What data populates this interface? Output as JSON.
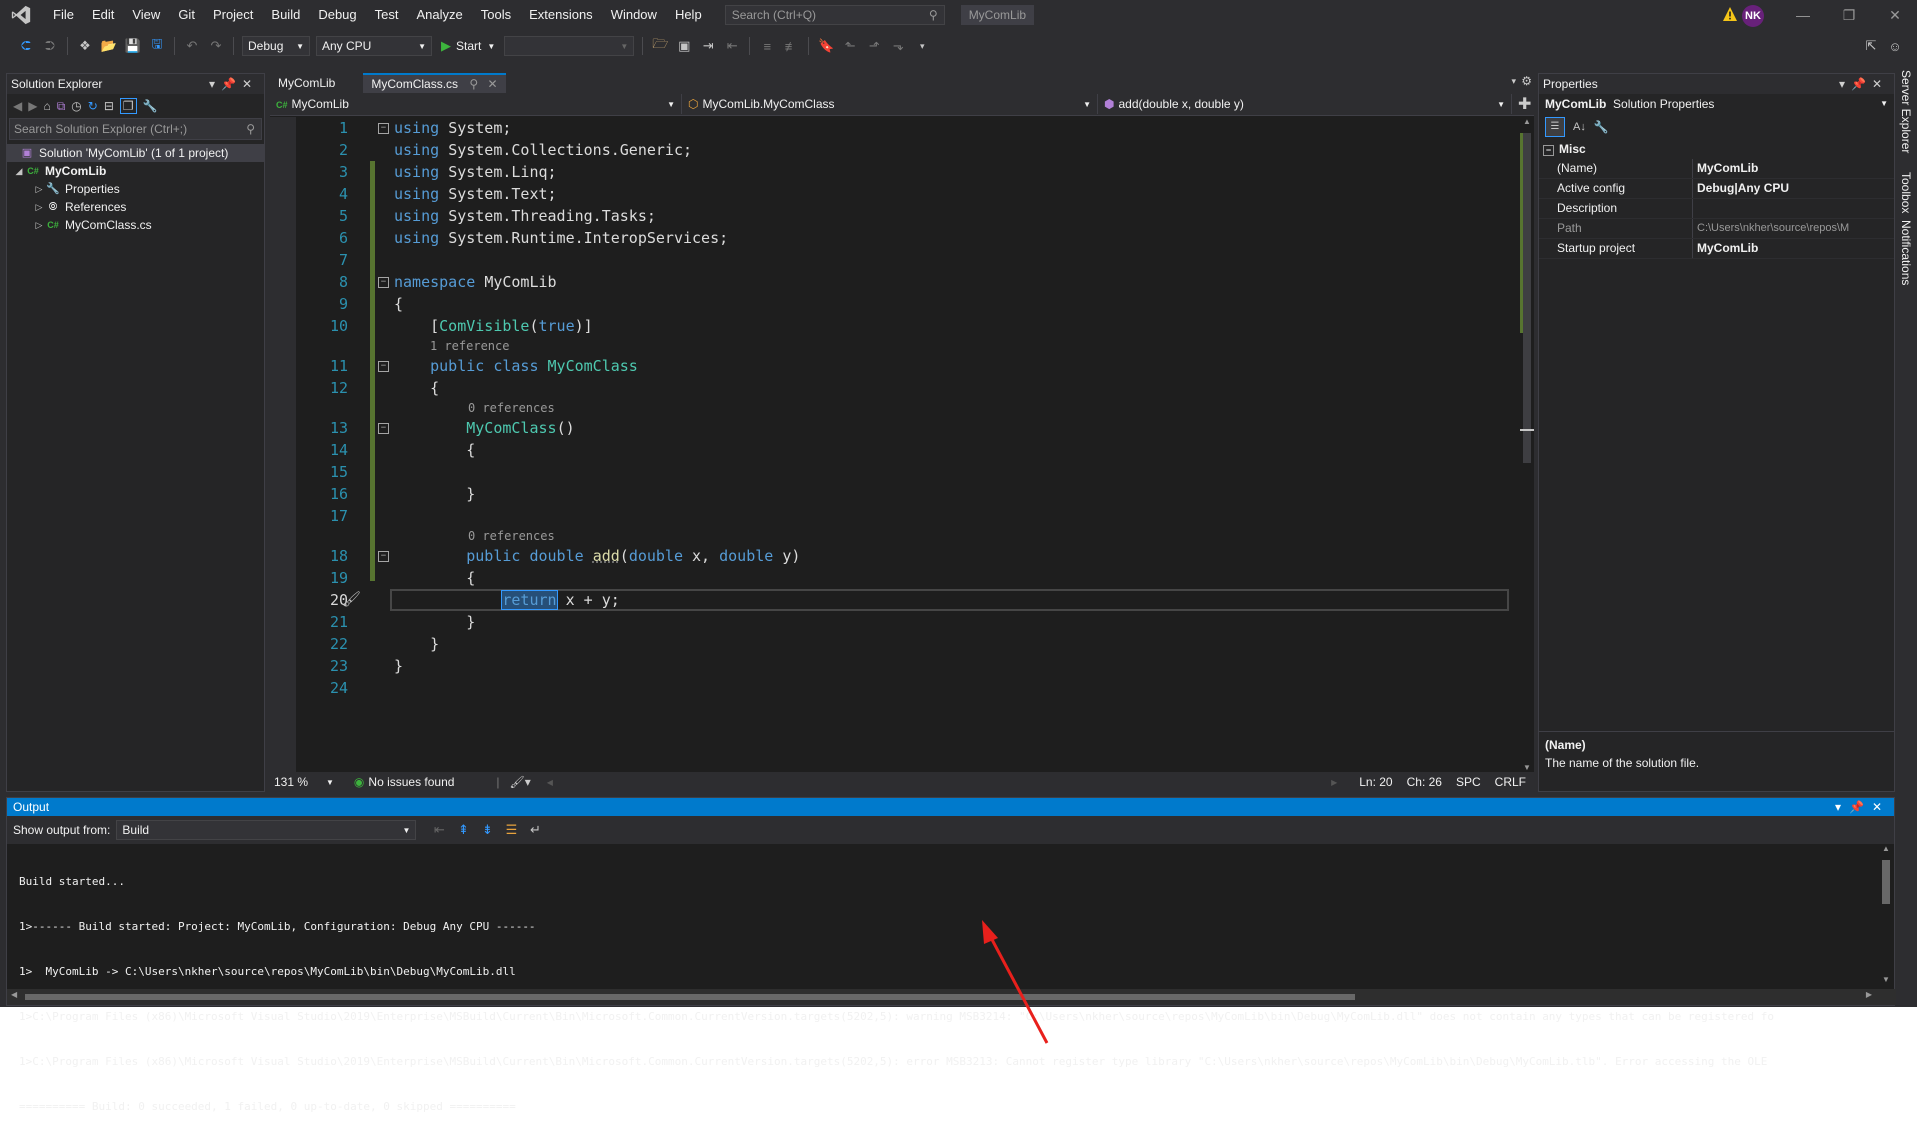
{
  "menu": [
    "File",
    "Edit",
    "View",
    "Git",
    "Project",
    "Build",
    "Debug",
    "Test",
    "Analyze",
    "Tools",
    "Extensions",
    "Window",
    "Help"
  ],
  "search": {
    "placeholder": "Search (Ctrl+Q)"
  },
  "window_title": "MyComLib",
  "avatar_initials": "NK",
  "toolbar": {
    "config": "Debug",
    "platform": "Any CPU",
    "start": "Start"
  },
  "solution_explorer": {
    "title": "Solution Explorer",
    "search_placeholder": "Search Solution Explorer (Ctrl+;)",
    "items": [
      {
        "label": "Solution 'MyComLib' (1 of 1 project)"
      },
      {
        "label": "MyComLib"
      },
      {
        "label": "Properties"
      },
      {
        "label": "References"
      },
      {
        "label": "MyComClass.cs"
      }
    ]
  },
  "editor": {
    "tabs": [
      "MyComLib",
      "MyComClass.cs"
    ],
    "nav": [
      "MyComLib",
      "MyComLib.MyComClass",
      "add(double x, double y)"
    ],
    "lens": {
      "ref1": "1 reference",
      "ref0a": "0 references",
      "ref0b": "0 references"
    },
    "status": {
      "zoom": "131 %",
      "issues": "No issues found",
      "ln": "Ln: 20",
      "ch": "Ch: 26",
      "spc": "SPC",
      "crlf": "CRLF"
    }
  },
  "code": {
    "l1": "System;",
    "l2": "System.Collections.Generic;",
    "l3": "System.Linq;",
    "l4": "System.Text;",
    "l5": "System.Threading.Tasks;",
    "l6": "System.Runtime.InteropServices;",
    "ns": "MyComLib",
    "attr": "ComVisible",
    "cls": "MyComClass",
    "ctor": "MyComClass",
    "method": "add",
    "ret": "x + y;"
  },
  "properties": {
    "title": "Properties",
    "object": "MyComLib",
    "object_type": "Solution Properties",
    "category": "Misc",
    "rows": [
      {
        "k": "(Name)",
        "v": "MyComLib"
      },
      {
        "k": "Active config",
        "v": "Debug|Any CPU"
      },
      {
        "k": "Description",
        "v": ""
      },
      {
        "k": "Path",
        "v": "C:\\Users\\nkher\\source\\repos\\M"
      },
      {
        "k": "Startup project",
        "v": "MyComLib"
      }
    ],
    "desc_title": "(Name)",
    "desc_text": "The name of the solution file."
  },
  "side_tabs": [
    "Server Explorer",
    "Toolbox",
    "Notifications"
  ],
  "output": {
    "title": "Output",
    "show_from_label": "Show output from:",
    "source": "Build",
    "lines": [
      "Build started...",
      "1>------ Build started: Project: MyComLib, Configuration: Debug Any CPU ------",
      "1>  MyComLib -> C:\\Users\\nkher\\source\\repos\\MyComLib\\bin\\Debug\\MyComLib.dll",
      "1>C:\\Program Files (x86)\\Microsoft Visual Studio\\2019\\Enterprise\\MSBuild\\Current\\Bin\\Microsoft.Common.CurrentVersion.targets(5202,5): warning MSB3214: \"C:\\Users\\nkher\\source\\repos\\MyComLib\\bin\\Debug\\MyComLib.dll\" does not contain any types that can be registered fo",
      "1>C:\\Program Files (x86)\\Microsoft Visual Studio\\2019\\Enterprise\\MSBuild\\Current\\Bin\\Microsoft.Common.CurrentVersion.targets(5202,5): error MSB3213: Cannot register type library \"C:\\Users\\nkher\\source\\repos\\MyComLib\\bin\\Debug\\MyComLib.tlb\". Error accessing the OLE",
      "========== Build: 0 succeeded, 1 failed, 0 up-to-date, 0 skipped =========="
    ]
  },
  "colors": {
    "accent": "#007acc",
    "annotation_arrow": "#e8201c"
  }
}
